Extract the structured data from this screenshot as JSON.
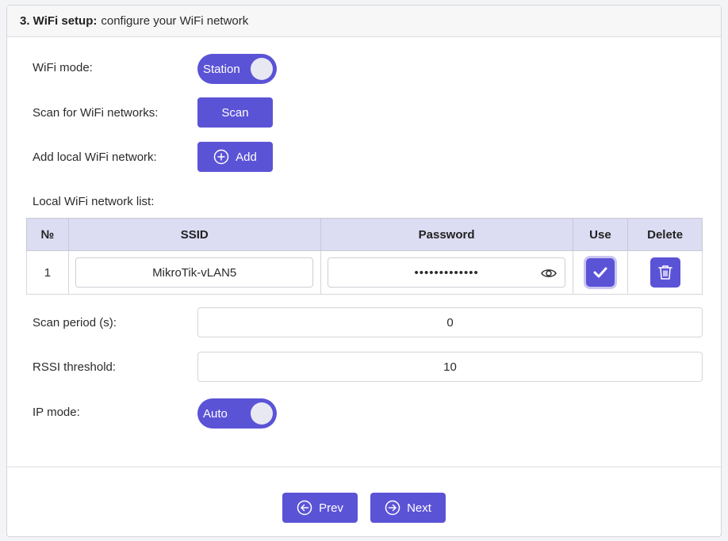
{
  "header": {
    "step_title": "3. WiFi setup:",
    "description": "configure your WiFi network"
  },
  "wifi_mode": {
    "label": "WiFi mode:",
    "value": "Station"
  },
  "scan": {
    "label": "Scan for WiFi networks:",
    "button": "Scan"
  },
  "add": {
    "label": "Add local WiFi network:",
    "button": "Add"
  },
  "network_list": {
    "label": "Local WiFi network list:",
    "columns": [
      "№",
      "SSID",
      "Password",
      "Use",
      "Delete"
    ],
    "rows": [
      {
        "num": "1",
        "ssid": "MikroTik-vLAN5",
        "password": "•••••••••••••",
        "use": true
      }
    ]
  },
  "scan_period": {
    "label": "Scan period (s):",
    "value": "0"
  },
  "rssi_threshold": {
    "label": "RSSI threshold:",
    "value": "10"
  },
  "ip_mode": {
    "label": "IP mode:",
    "value": "Auto"
  },
  "nav": {
    "prev": "Prev",
    "next": "Next"
  },
  "colors": {
    "accent": "#5b53d6",
    "table_header": "#dcdcf3"
  },
  "icons": [
    "plus-circle-icon",
    "eye-icon",
    "check-icon",
    "trash-icon",
    "arrow-left-circle-icon",
    "arrow-right-circle-icon"
  ]
}
